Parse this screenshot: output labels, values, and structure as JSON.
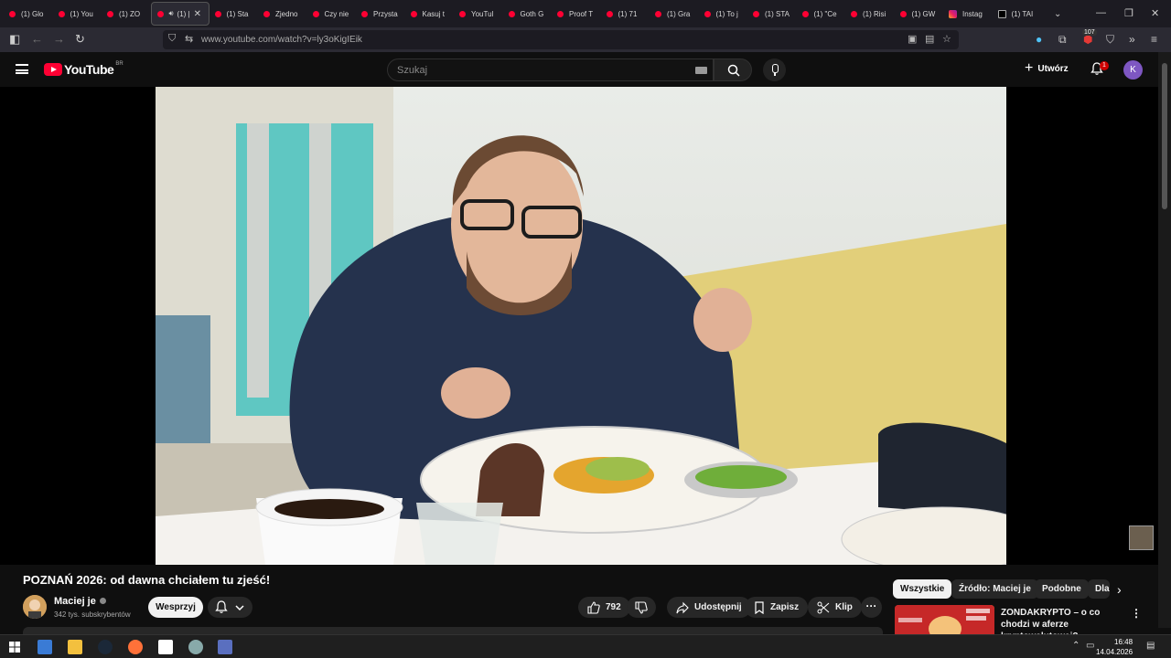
{
  "browser": {
    "tabs": [
      {
        "label": "(1) Glo",
        "icon": "youtube"
      },
      {
        "label": "(1) You",
        "icon": "youtube"
      },
      {
        "label": "(1) ZO",
        "icon": "youtube"
      },
      {
        "label": "(1) |",
        "icon": "youtube",
        "active": true,
        "audio": true
      },
      {
        "label": "(1) Sta",
        "icon": "youtube"
      },
      {
        "label": "Zjedno",
        "icon": "youtube"
      },
      {
        "label": "Czy nie",
        "icon": "youtube"
      },
      {
        "label": "Przysta",
        "icon": "youtube"
      },
      {
        "label": "Kasuj t",
        "icon": "youtube"
      },
      {
        "label": "YouTul",
        "icon": "youtube"
      },
      {
        "label": "Goth G",
        "icon": "youtube"
      },
      {
        "label": "Proof T",
        "icon": "youtube"
      },
      {
        "label": "(1) 71",
        "icon": "youtube"
      },
      {
        "label": "(1) Gra",
        "icon": "youtube"
      },
      {
        "label": "(1) To j",
        "icon": "youtube"
      },
      {
        "label": "(1) STA",
        "icon": "youtube"
      },
      {
        "label": "(1) \"Ce",
        "icon": "youtube"
      },
      {
        "label": "(1) Risi",
        "icon": "youtube"
      },
      {
        "label": "(1) GW",
        "icon": "youtube"
      },
      {
        "label": "Instag",
        "icon": "instagram"
      },
      {
        "label": "(1) TAI",
        "icon": "x"
      }
    ],
    "url": "www.youtube.com/watch?v=ly3oKigIEik",
    "extension_badge": "107"
  },
  "youtube": {
    "logo_text": "YouTube",
    "country_code": "BR",
    "search_placeholder": "Szukaj",
    "create_label": "Utwórz",
    "notification_count": "1",
    "avatar_letter": "K"
  },
  "video": {
    "title": "POZNAŃ 2026: od dawna chciałem tu zjeść!",
    "channel_name": "Maciej je",
    "subscribers": "342 tys. subskrybentów",
    "support_label": "Wesprzyj",
    "likes": "792",
    "share_label": "Udostępnij",
    "save_label": "Zapisz",
    "clip_label": "Klip"
  },
  "chips": [
    "Wszystkie",
    "Źródło: Maciej je",
    "Podobne",
    "Dla"
  ],
  "recommended": [
    {
      "title": "ZONDAKRYPTO – o co chodzi w aferze kryptowalutowej?"
    }
  ],
  "taskbar": {
    "time": "16:48",
    "date": "14.04.2026"
  },
  "colors": {
    "yt_red": "#ff0033",
    "background": "#0f0f0f",
    "avatar": "#7e57c2"
  }
}
